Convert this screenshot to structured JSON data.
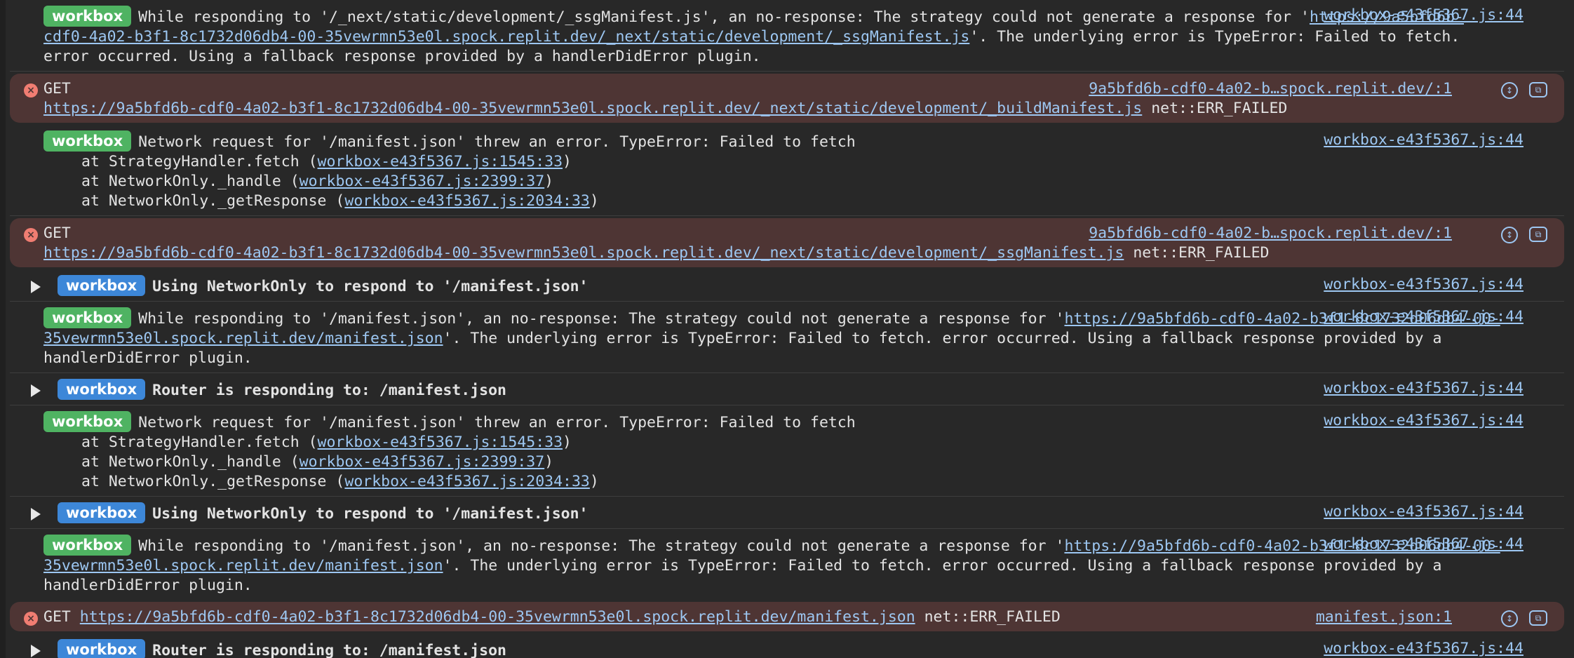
{
  "badge": "workbox",
  "src": "workbox-e43f5367.js:44",
  "err_src_host": "9a5bfd6b-cdf0-4a02-b…spock.replit.dev/:1",
  "err_src_manifest": "manifest.json:1",
  "messages": {
    "m1": {
      "t1": "While responding to '/_next/static/development/_ssgManifest.js', an no-response: The strategy could not generate a response for '",
      "link": "https://9a5bfd6b-cdf0-4a02-b3f1-8c1732d06db4-00-35vewrmn53e0l.spock.replit.dev/_next/static/development/_ssgManifest.js",
      "t2": "'. The underlying error is TypeError: Failed to fetch. error occurred. Using a fallback response provided by a handlerDidError plugin."
    },
    "e1": {
      "method": "GET",
      "link": "https://9a5bfd6b-cdf0-4a02-b3f1-8c1732d06db4-00-35vewrmn53e0l.spock.replit.dev/_next/static/development/_buildManifest.js",
      "status": "net::ERR_FAILED"
    },
    "m2": {
      "text": "Network request for '/manifest.json' threw an error. TypeError: Failed to fetch",
      "s1_pre": "at StrategyHandler.fetch (",
      "s1_link": "workbox-e43f5367.js:1545:33",
      "s2_pre": "at NetworkOnly._handle (",
      "s2_link": "workbox-e43f5367.js:2399:37",
      "s3_pre": "at NetworkOnly._getResponse (",
      "s3_link": "workbox-e43f5367.js:2034:33",
      "close": ")"
    },
    "e2": {
      "method": "GET",
      "link": "https://9a5bfd6b-cdf0-4a02-b3f1-8c1732d06db4-00-35vewrmn53e0l.spock.replit.dev/_next/static/development/_ssgManifest.js",
      "status": "net::ERR_FAILED"
    },
    "g1": {
      "text": "Using NetworkOnly to respond to '/manifest.json'"
    },
    "m3": {
      "t1": "While responding to '/manifest.json', an no-response: The strategy could not generate a response for '",
      "link": "https://9a5bfd6b-cdf0-4a02-b3f1-8c1732d06db4-00-35vewrmn53e0l.spock.replit.dev/manifest.json",
      "t2": "'. The underlying error is TypeError: Failed to fetch. error occurred. Using a fallback response provided by a handlerDidError plugin."
    },
    "g2": {
      "text": "Router is responding to: /manifest.json"
    },
    "e3": {
      "method": "GET",
      "link": "https://9a5bfd6b-cdf0-4a02-b3f1-8c1732d06db4-00-35vewrmn53e0l.spock.replit.dev/manifest.json",
      "status": "net::ERR_FAILED"
    }
  },
  "icons": {
    "error": "×",
    "reveal": "↕",
    "copy": "⧉"
  }
}
